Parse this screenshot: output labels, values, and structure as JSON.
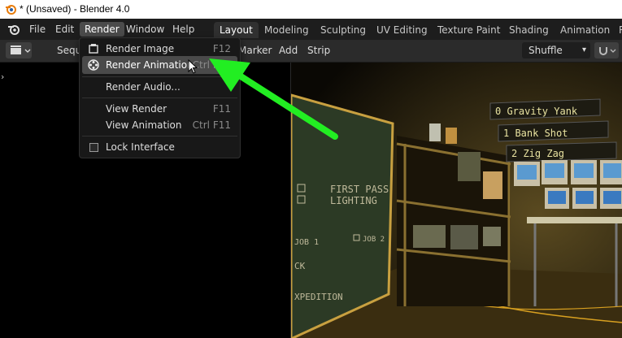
{
  "window": {
    "title": "* (Unsaved) - Blender 4.0"
  },
  "menubar": {
    "items": [
      {
        "label": "File"
      },
      {
        "label": "Edit"
      },
      {
        "label": "Render"
      },
      {
        "label": "Window"
      },
      {
        "label": "Help"
      }
    ]
  },
  "workspace_tabs": [
    {
      "label": "Layout"
    },
    {
      "label": "Modeling"
    },
    {
      "label": "Sculpting"
    },
    {
      "label": "UV Editing"
    },
    {
      "label": "Texture Paint"
    },
    {
      "label": "Shading"
    },
    {
      "label": "Animation"
    },
    {
      "label": "R"
    }
  ],
  "toolbar": {
    "sequencer_label": "Sequ",
    "marker_label": "Marker",
    "add_label": "Add",
    "strip_label": "Strip",
    "mode_dropdown": "Shuffle"
  },
  "render_menu": {
    "items": [
      {
        "label": "Render Image",
        "shortcut": "F12"
      },
      {
        "label": "Render Animation",
        "shortcut": "Ctrl F12"
      },
      {
        "label": "Render Audio..."
      },
      {
        "label": "View Render",
        "shortcut": "F11"
      },
      {
        "label": "View Animation",
        "shortcut": "Ctrl F11"
      },
      {
        "label": "Lock Interface"
      }
    ]
  },
  "viewport": {
    "chalkboard_lines": [
      "FIRST PASS",
      "LIGHTING",
      "JOB 1",
      "JOB 2",
      "CK",
      "XPEDITION"
    ],
    "banner_lines": [
      "0 Gravity Yank",
      "1 Bank Shot",
      "2 Zig Zag"
    ]
  },
  "colors": {
    "arrow": "#22ee22",
    "menu_hover": "#4a4a4a",
    "menubar": "#1d1d1d"
  }
}
